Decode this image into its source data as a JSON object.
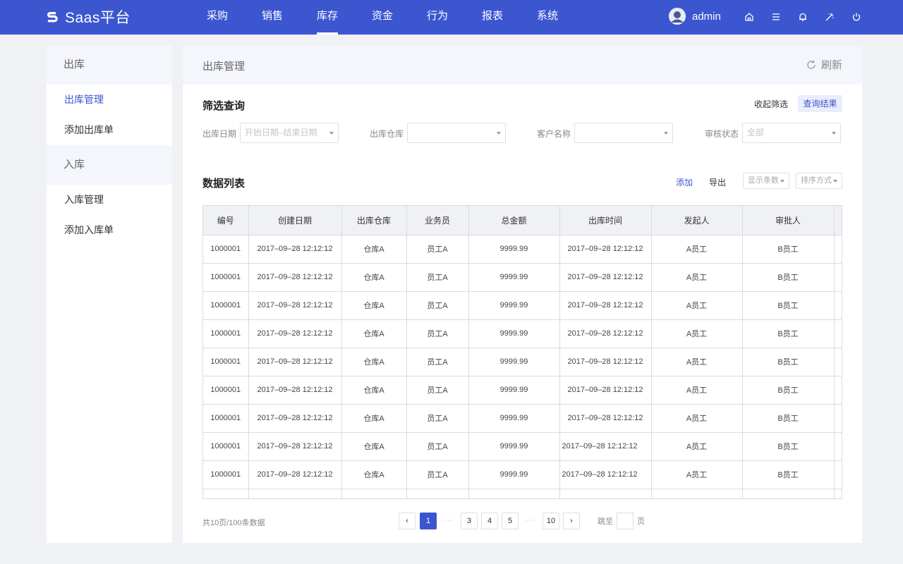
{
  "app": {
    "name": "Saas平台",
    "brand_color": "#3c56d0"
  },
  "nav": {
    "items": [
      "采购",
      "销售",
      "库存",
      "资金",
      "行为",
      "报表",
      "系统"
    ],
    "active_index": 2
  },
  "user": {
    "name": "admin"
  },
  "header_icons": [
    "home-icon",
    "menu-icon",
    "bell-icon",
    "magic-wand-icon",
    "power-icon"
  ],
  "sidebar": {
    "groups": [
      {
        "title": "出库",
        "items": [
          "出库管理",
          "添加出库单"
        ]
      },
      {
        "title": "入库",
        "items": [
          "入库管理",
          "添加入库单"
        ]
      }
    ],
    "active_item": "出库管理"
  },
  "main": {
    "title": "出库管理",
    "refresh_label": "刷新"
  },
  "filter": {
    "title": "筛选查询",
    "collapse_label": "收起筛选",
    "query_label": "查询结果",
    "fields": [
      {
        "label": "出库日期",
        "value": "开始日期–结束日期"
      },
      {
        "label": "出库仓库",
        "value": ""
      },
      {
        "label": "客户名称",
        "value": ""
      },
      {
        "label": "审核状态",
        "value": "全部"
      }
    ]
  },
  "list": {
    "title": "数据列表",
    "add_label": "添加",
    "export_label": "导出",
    "page_size_placeholder": "显示条数",
    "sort_placeholder": "排序方式"
  },
  "table": {
    "columns": [
      "编号",
      "创建日期",
      "出库仓库",
      "业务员",
      "总金额",
      "出库时间",
      "发起人",
      "审批人"
    ],
    "rows": [
      [
        "1000001",
        "2017–09–28 12:12:12",
        "仓库A",
        "员工A",
        "9999.99",
        "2017–09–28 12:12:12",
        "A员工",
        "B员工"
      ],
      [
        "1000001",
        "2017–09–28 12:12:12",
        "仓库A",
        "员工A",
        "9999.99",
        "2017–09–28 12:12:12",
        "A员工",
        "B员工"
      ],
      [
        "1000001",
        "2017–09–28 12:12:12",
        "仓库A",
        "员工A",
        "9999.99",
        "2017–09–28 12:12:12",
        "A员工",
        "B员工"
      ],
      [
        "1000001",
        "2017–09–28 12:12:12",
        "仓库A",
        "员工A",
        "9999.99",
        "2017–09–28 12:12:12",
        "A员工",
        "B员工"
      ],
      [
        "1000001",
        "2017–09–28 12:12:12",
        "仓库A",
        "员工A",
        "9999.99",
        "2017–09–28 12:12:12",
        "A员工",
        "B员工"
      ],
      [
        "1000001",
        "2017–09–28 12:12:12",
        "仓库A",
        "员工A",
        "9999.99",
        "2017–09–28 12:12:12",
        "A员工",
        "B员工"
      ],
      [
        "1000001",
        "2017–09–28 12:12:12",
        "仓库A",
        "员工A",
        "9999.99",
        "2017–09–28 12:12:12",
        "A员工",
        "B员工"
      ],
      [
        "1000001",
        "2017–09–28 12:12:12",
        "仓库A",
        "员工A",
        "9999.99",
        "2017–09–28 12:12:12",
        "A员工",
        "B员工"
      ],
      [
        "1000001",
        "2017–09–28 12:12:12",
        "仓库A",
        "员工A",
        "9999.99",
        "2017–09–28 12:12:12",
        "A员工",
        "B员工"
      ]
    ]
  },
  "pagination": {
    "summary": "共10页/100条数据",
    "pages": [
      "1",
      "···",
      "3",
      "4",
      "5",
      "···",
      "10"
    ],
    "current": "1",
    "prev": "‹",
    "next": "›",
    "jump_prefix": "跳至",
    "jump_suffix": "页"
  }
}
